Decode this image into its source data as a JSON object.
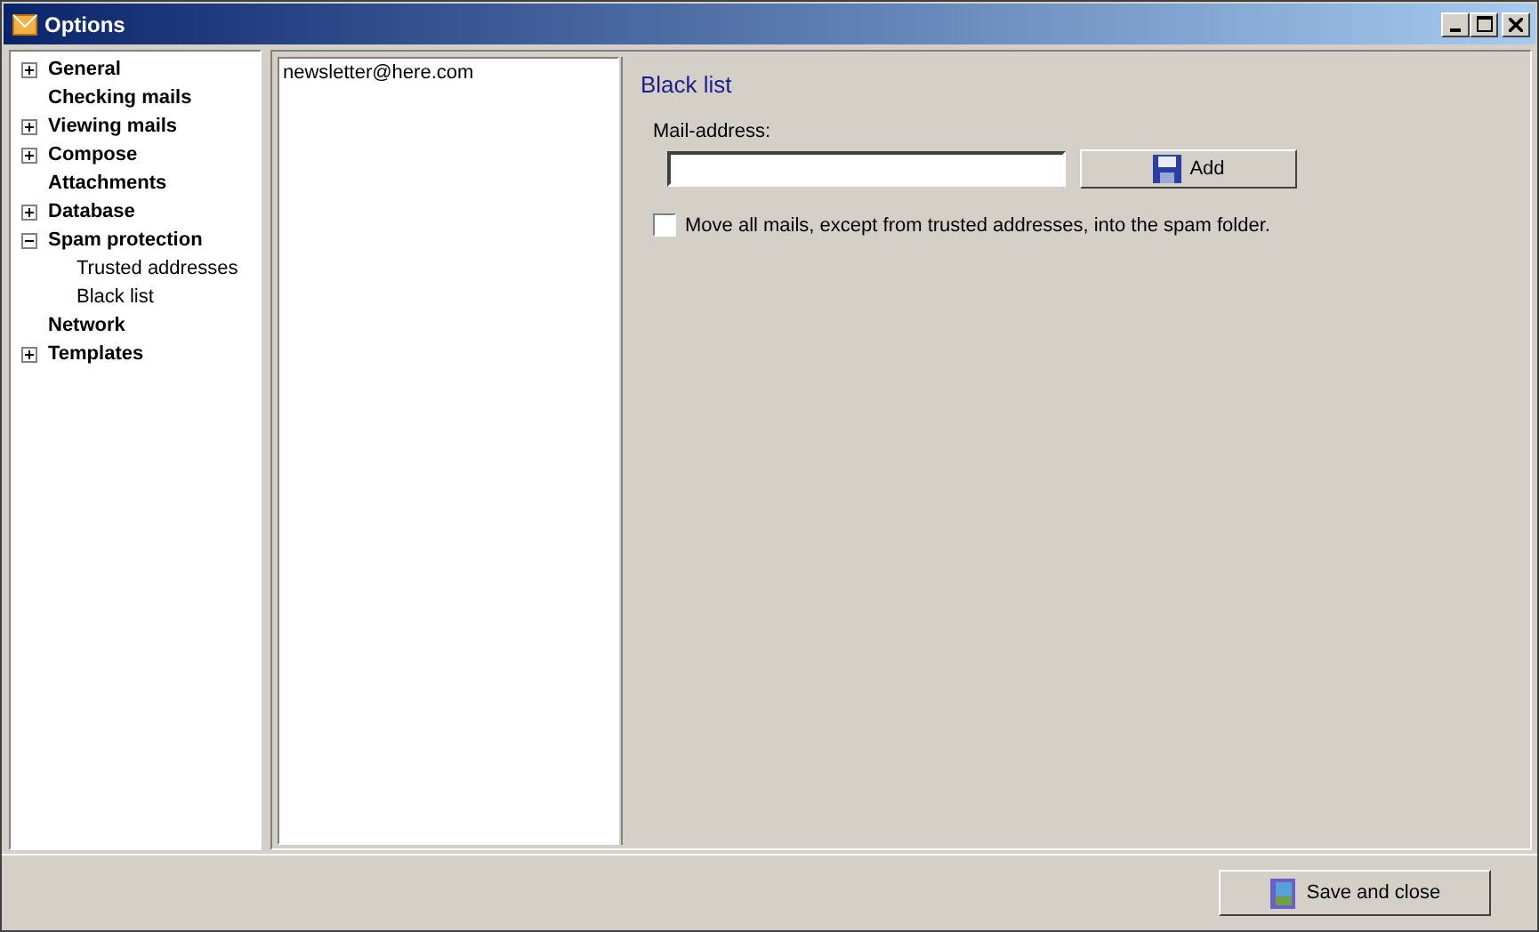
{
  "window": {
    "title": "Options"
  },
  "tree": [
    {
      "label": "General",
      "expanded": false
    },
    {
      "label": "Checking mails"
    },
    {
      "label": "Viewing mails",
      "expanded": false
    },
    {
      "label": "Compose",
      "expanded": false
    },
    {
      "label": "Attachments"
    },
    {
      "label": "Database",
      "expanded": false
    },
    {
      "label": "Spam protection",
      "expanded": true,
      "children": [
        {
          "label": "Trusted addresses"
        },
        {
          "label": "Black list"
        }
      ]
    },
    {
      "label": "Network"
    },
    {
      "label": "Templates",
      "expanded": false
    }
  ],
  "address_list": [
    "newsletter@here.com"
  ],
  "panel": {
    "heading": "Black list",
    "field_label": "Mail-address:",
    "add_button": "Add",
    "checkbox": {
      "label": "Move all mails, except from trusted addresses, into the spam folder.",
      "checked": false
    }
  },
  "footer": {
    "save_button": "Save and close"
  }
}
